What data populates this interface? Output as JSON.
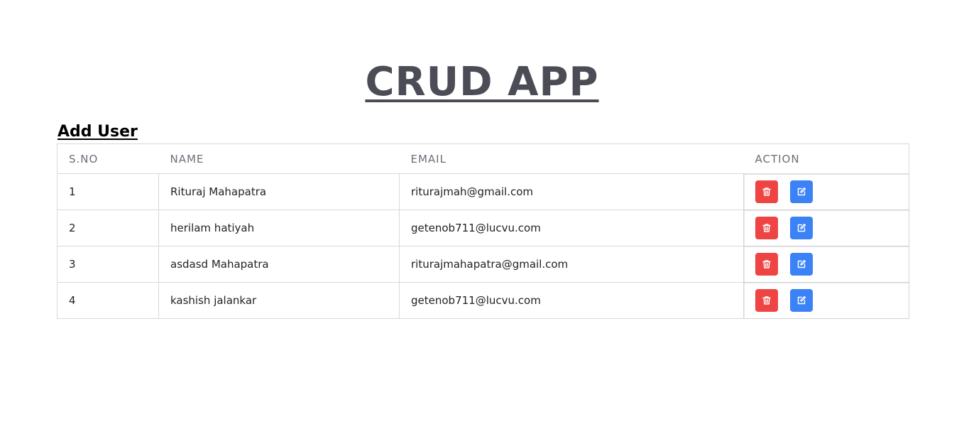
{
  "app": {
    "title": "CRUD APP"
  },
  "actions": {
    "add_user_label": "Add User"
  },
  "table": {
    "headers": [
      "S.NO",
      "NAME",
      "EMAIL",
      "ACTION"
    ],
    "rows": [
      {
        "sno": "1",
        "name": "Rituraj Mahapatra",
        "email": "riturajmah@gmail.com"
      },
      {
        "sno": "2",
        "name": "herilam hatiyah",
        "email": "getenob711@lucvu.com"
      },
      {
        "sno": "3",
        "name": "asdasd Mahapatra",
        "email": "riturajmahapatra@gmail.com"
      },
      {
        "sno": "4",
        "name": "kashish jalankar",
        "email": "getenob711@lucvu.com"
      }
    ]
  },
  "icons": {
    "delete": "trash-icon",
    "edit": "edit-icon"
  },
  "colors": {
    "title": "#4b4c55",
    "delete_button": "#ef4444",
    "edit_button": "#3b82f6",
    "border": "#d9d9d9"
  }
}
